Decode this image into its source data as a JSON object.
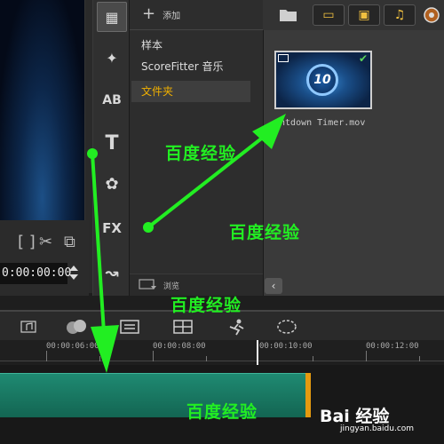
{
  "preview": {
    "controls": {
      "bracket_glyph": "[ ]",
      "scissors_glyph": "✂",
      "copy_glyph": "⧉"
    },
    "timecode": "0:00:00:00"
  },
  "category_bar": {
    "items": [
      {
        "name": "media",
        "glyph": "▦"
      },
      {
        "name": "instant-project",
        "glyph": "✦"
      },
      {
        "name": "transition",
        "glyph": "AB"
      },
      {
        "name": "title",
        "glyph": "T"
      },
      {
        "name": "graphic",
        "glyph": "✿"
      },
      {
        "name": "filter",
        "glyph": "FX"
      },
      {
        "name": "path",
        "glyph": "↝"
      }
    ]
  },
  "folders": {
    "add_label": "添加",
    "items": [
      "样本",
      "ScoreFitter 音乐",
      "文件夹"
    ],
    "selected_index": 2,
    "browse_label": "浏览"
  },
  "library": {
    "tools": [
      "▭",
      "▣",
      "♫"
    ],
    "tool_colors": [
      "#f0c040",
      "#f0c040",
      "#f0c040"
    ],
    "thumbnail": {
      "number": "10",
      "label": "untdown Timer.mov"
    },
    "scroll_left_glyph": "‹"
  },
  "timeline": {
    "ruler": [
      "00:00:06:00",
      "00:00:08:00",
      "00:00:10:00",
      "00:00:12:00"
    ]
  },
  "annotations": {
    "watermark_text": "百度经验",
    "baidu_logo": "Bai 经验",
    "baidu_url": "jingyan.baidu.com",
    "arrow_color": "#22ee22"
  }
}
